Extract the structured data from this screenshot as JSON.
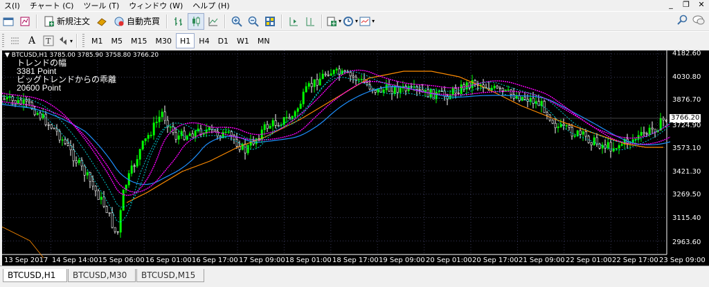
{
  "menu": [
    "ス(I)",
    "チャート (C)",
    "ツール (T)",
    "ウィンドウ (W)",
    "ヘルプ (H)"
  ],
  "toolbar": {
    "new_order": "新規注文",
    "autotrade": "自動売買"
  },
  "timeframes": [
    "M1",
    "M5",
    "M15",
    "M30",
    "H1",
    "H4",
    "D1",
    "W1",
    "MN"
  ],
  "active_timeframe": "H1",
  "chart": {
    "header": "BTCUSD,H1  3785.00 3785.90 3758.80 3766.20",
    "overlay": [
      "トレンドの幅",
      "3381 Point",
      "ビッグトレンドからの乖離",
      "20600 Point"
    ],
    "current_price": "3766.20",
    "price_labels": [
      "4182.60",
      "4030.80",
      "3876.70",
      "3724.90",
      "3573.10",
      "3421.30",
      "3269.50",
      "3115.40",
      "2963.60"
    ],
    "time_labels": [
      "13 Sep 2017",
      "14 Sep 14:00",
      "15 Sep 06:00",
      "16 Sep 01:00",
      "16 Sep 17:00",
      "17 Sep 09:00",
      "18 Sep 01:00",
      "18 Sep 17:00",
      "19 Sep 09:00",
      "20 Sep 01:00",
      "20 Sep 17:00",
      "21 Sep 09:00",
      "22 Sep 01:00",
      "22 Sep 17:00",
      "23 Sep 09:00"
    ],
    "colors": {
      "bull": "#00ff00",
      "bear": "#ffffff",
      "ma_fast": "#1e90ff",
      "ma_slow": "#ff8c00",
      "band_magenta": "#ff00ff",
      "band_cyan": "#00ced1",
      "grid": "#3a3a5a"
    }
  },
  "tabs": [
    "BTCUSD,H1",
    "BTCUSD,M30",
    "BTCUSD,M15"
  ],
  "active_tab": "BTCUSD,H1"
}
